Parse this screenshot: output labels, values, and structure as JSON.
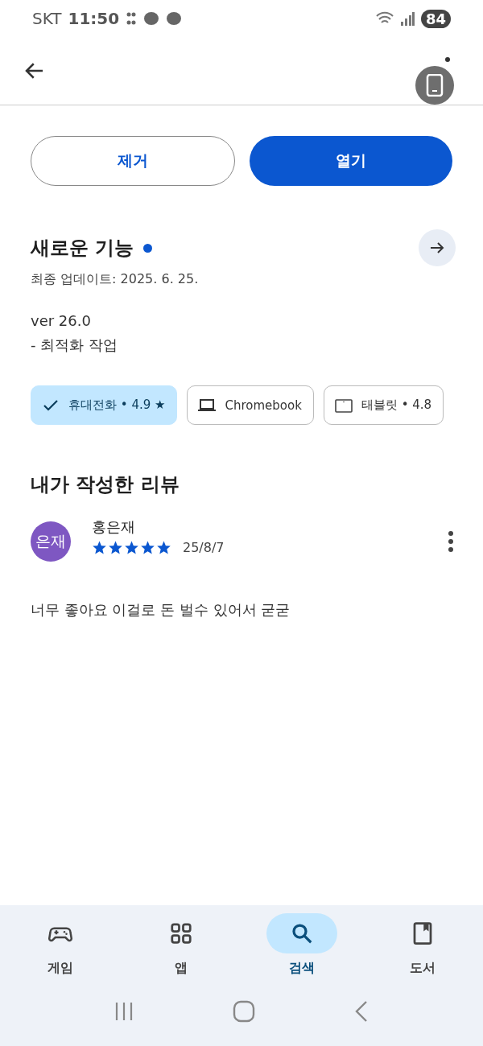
{
  "status_bar": {
    "carrier": "SKT",
    "time": "11:50",
    "battery": "84"
  },
  "actions": {
    "uninstall": "제거",
    "open": "열기"
  },
  "whats_new": {
    "title": "새로운 기능",
    "new_dot": true,
    "updated": "최종 업데이트: 2025. 6. 25.",
    "notes": [
      "ver 26.0",
      "- 최적화 작업"
    ]
  },
  "device_chips": [
    {
      "label": "휴대전화 • 4.9 ★",
      "selected": true
    },
    {
      "label": "Chromebook",
      "selected": false,
      "kind": "laptop"
    },
    {
      "label": "태블릿 • 4.8",
      "selected": false,
      "kind": "tablet"
    }
  ],
  "my_review": {
    "heading": "내가 작성한 리뷰",
    "avatar": "은재",
    "color": "#7e57c2",
    "author": "홍은재",
    "stars": 5,
    "date": "25/8/7",
    "text": "너무 좋아요 이걸로 돈 벌수 있어서 굳굳"
  },
  "bottom_nav": [
    {
      "label": "게임",
      "kind": "games",
      "selected": false
    },
    {
      "label": "앱",
      "kind": "apps",
      "selected": false
    },
    {
      "label": "검색",
      "kind": "search",
      "selected": true
    },
    {
      "label": "도서",
      "kind": "books",
      "selected": false
    }
  ]
}
